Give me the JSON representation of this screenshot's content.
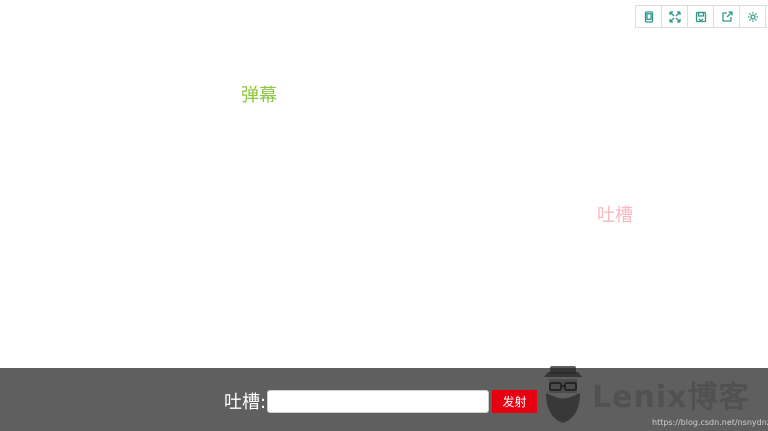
{
  "toolbar": {
    "buttons": [
      {
        "icon": "tablet-icon"
      },
      {
        "icon": "fullscreen-icon"
      },
      {
        "icon": "save-icon"
      },
      {
        "icon": "share-icon"
      },
      {
        "icon": "gear-icon"
      }
    ],
    "icon_color": "#2f9a8a"
  },
  "danmaku": [
    {
      "text": "弹幕",
      "color": "#8cc63f"
    },
    {
      "text": "吐槽",
      "color": "#f7b9bf"
    }
  ],
  "bottom_bar": {
    "label": "吐槽:",
    "input_value": "",
    "send_label": "发射",
    "send_color": "#e60012",
    "background": "#5f5f5f"
  },
  "watermark": {
    "brand": "Lenix博客",
    "url": "https://blog.csdn.net/nsnydnz"
  }
}
